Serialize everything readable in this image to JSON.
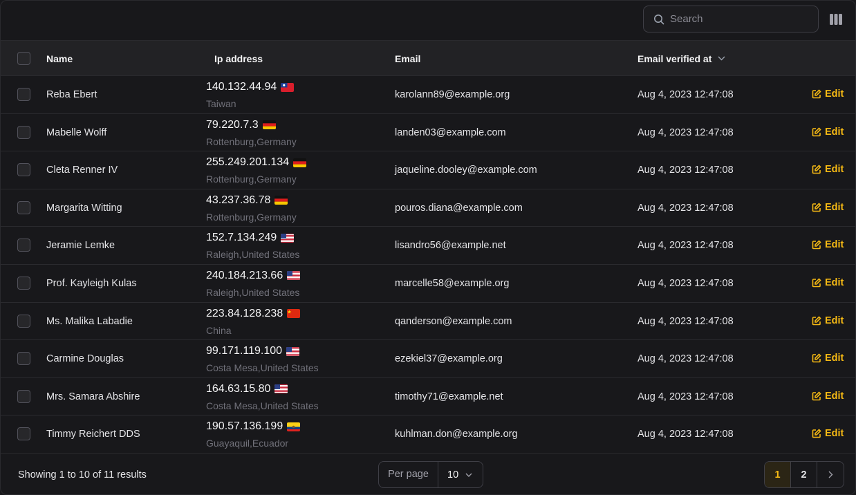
{
  "toolbar": {
    "search_placeholder": "Search",
    "search_icon": "search-icon",
    "columns_icon": "columns-icon"
  },
  "table": {
    "headers": {
      "name": "Name",
      "ip": "Ip address",
      "email": "Email",
      "verified": "Email verified at"
    },
    "sort_icon": "chevron-down-icon",
    "edit_label": "Edit",
    "rows": [
      {
        "name": "Reba Ebert",
        "ip": "140.132.44.94",
        "location": "Taiwan",
        "flag": "tw",
        "email": "karolann89@example.org",
        "verified": "Aug 4, 2023 12:47:08"
      },
      {
        "name": "Mabelle Wolff",
        "ip": "79.220.7.3",
        "location": "Rottenburg,Germany",
        "flag": "de",
        "email": "landen03@example.com",
        "verified": "Aug 4, 2023 12:47:08"
      },
      {
        "name": "Cleta Renner IV",
        "ip": "255.249.201.134",
        "location": "Rottenburg,Germany",
        "flag": "de",
        "email": "jaqueline.dooley@example.com",
        "verified": "Aug 4, 2023 12:47:08"
      },
      {
        "name": "Margarita Witting",
        "ip": "43.237.36.78",
        "location": "Rottenburg,Germany",
        "flag": "de",
        "email": "pouros.diana@example.com",
        "verified": "Aug 4, 2023 12:47:08"
      },
      {
        "name": "Jeramie Lemke",
        "ip": "152.7.134.249",
        "location": "Raleigh,United States",
        "flag": "us",
        "email": "lisandro56@example.net",
        "verified": "Aug 4, 2023 12:47:08"
      },
      {
        "name": "Prof. Kayleigh Kulas",
        "ip": "240.184.213.66",
        "location": "Raleigh,United States",
        "flag": "us",
        "email": "marcelle58@example.org",
        "verified": "Aug 4, 2023 12:47:08"
      },
      {
        "name": "Ms. Malika Labadie",
        "ip": "223.84.128.238",
        "location": "China",
        "flag": "cn",
        "email": "qanderson@example.com",
        "verified": "Aug 4, 2023 12:47:08"
      },
      {
        "name": "Carmine Douglas",
        "ip": "99.171.119.100",
        "location": "Costa Mesa,United States",
        "flag": "us",
        "email": "ezekiel37@example.org",
        "verified": "Aug 4, 2023 12:47:08"
      },
      {
        "name": "Mrs. Samara Abshire",
        "ip": "164.63.15.80",
        "location": "Costa Mesa,United States",
        "flag": "us",
        "email": "timothy71@example.net",
        "verified": "Aug 4, 2023 12:47:08"
      },
      {
        "name": "Timmy Reichert DDS",
        "ip": "190.57.136.199",
        "location": "Guayaquil,Ecuador",
        "flag": "ec",
        "email": "kuhlman.don@example.org",
        "verified": "Aug 4, 2023 12:47:08"
      }
    ]
  },
  "footer": {
    "showing": "Showing 1 to 10 of 11 results",
    "per_page_label": "Per page",
    "per_page_value": "10",
    "pages": [
      "1",
      "2"
    ],
    "active_page": "1"
  },
  "colors": {
    "accent": "#f5b914",
    "background": "#18181b",
    "header": "#222225"
  }
}
